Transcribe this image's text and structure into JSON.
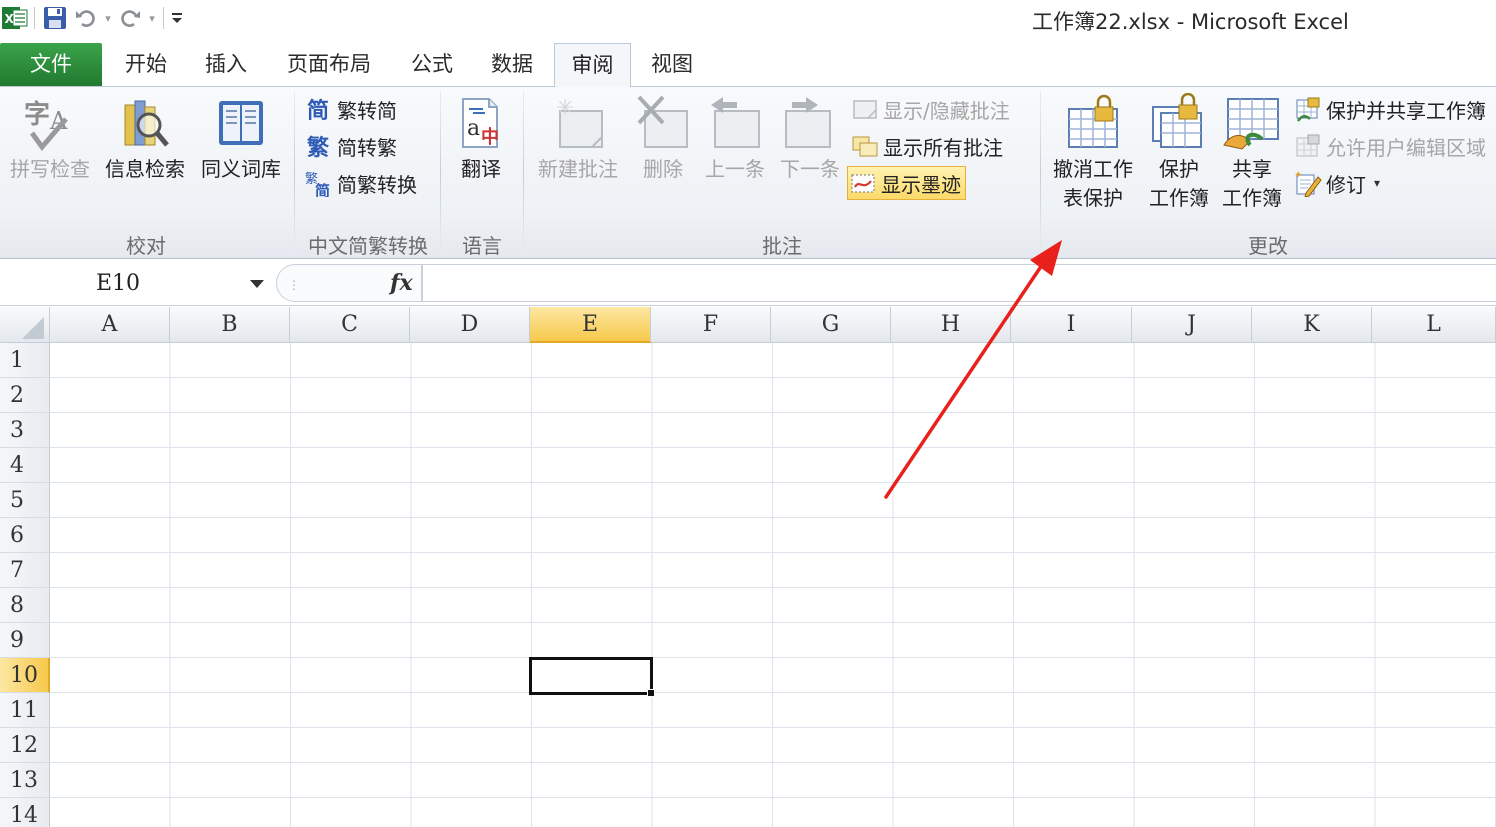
{
  "window": {
    "title": "工作簿22.xlsx  -  Microsoft Excel"
  },
  "quick_access": {
    "icons": [
      "excel-logo-icon",
      "save-icon",
      "undo-icon",
      "redo-icon",
      "customize-qat-icon"
    ]
  },
  "tabs": [
    {
      "id": "file",
      "label": "文件"
    },
    {
      "id": "home",
      "label": "开始"
    },
    {
      "id": "insert",
      "label": "插入"
    },
    {
      "id": "page-layout",
      "label": "页面布局"
    },
    {
      "id": "formulas",
      "label": "公式"
    },
    {
      "id": "data",
      "label": "数据"
    },
    {
      "id": "review",
      "label": "审阅"
    },
    {
      "id": "view",
      "label": "视图"
    }
  ],
  "active_tab": "审阅",
  "ribbon": {
    "proofing": {
      "label": "校对",
      "spelling": "拼写检查",
      "research": "信息检索",
      "thesaurus": "同义词库"
    },
    "chinese_conversion": {
      "label": "中文简繁转换",
      "to_simplified": "繁转简",
      "to_traditional": "简转繁",
      "conversion": "简繁转换"
    },
    "language": {
      "label": "语言",
      "translate": "翻译"
    },
    "comments": {
      "label": "批注",
      "new_comment": "新建批注",
      "delete": "删除",
      "previous": "上一条",
      "next": "下一条",
      "show_hide": "显示/隐藏批注",
      "show_all": "显示所有批注",
      "show_ink": "显示墨迹"
    },
    "changes": {
      "label": "更改",
      "unprotect_sheet_line1": "撤消工作",
      "unprotect_sheet_line2": "表保护",
      "protect_workbook_line1": "保护",
      "protect_workbook_line2": "工作簿",
      "share_workbook_line1": "共享",
      "share_workbook_line2": "工作簿",
      "protect_share": "保护并共享工作簿",
      "allow_edit_ranges": "允许用户编辑区域",
      "track_changes": "修订"
    }
  },
  "formula_bar": {
    "name_box": "E10",
    "fx_label": "fx",
    "formula": ""
  },
  "grid": {
    "columns": [
      "A",
      "B",
      "C",
      "D",
      "E",
      "F",
      "G",
      "H",
      "I",
      "J",
      "K",
      "L"
    ],
    "rows": [
      "1",
      "2",
      "3",
      "4",
      "5",
      "6",
      "7",
      "8",
      "9",
      "10",
      "11",
      "12",
      "13",
      "14"
    ],
    "selected_column": "E",
    "selected_row": "10"
  },
  "colors": {
    "file_tab": "#217a2f",
    "selection_header": "#f7c94c",
    "annotation_arrow": "#e8211c"
  }
}
